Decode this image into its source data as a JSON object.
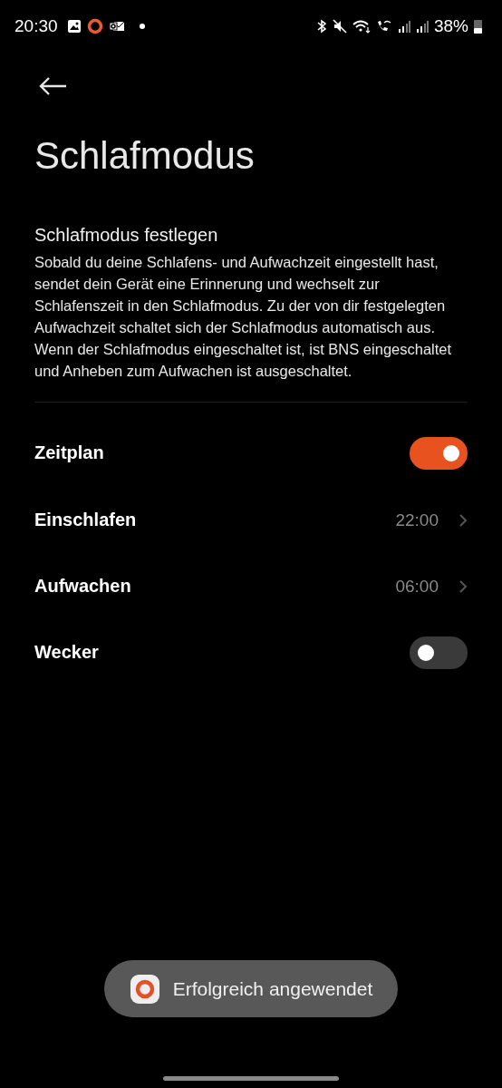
{
  "status_bar": {
    "time": "20:30",
    "battery": "38%"
  },
  "title": "Schlafmodus",
  "section": {
    "heading": "Schlafmodus festlegen",
    "description": "Sobald du deine Schlafens- und Aufwachzeit eingestellt hast, sendet dein Gerät eine Erinnerung und wechselt zur Schlafenszeit in den Schlafmodus. Zu der von dir festgelegten Aufwachzeit schaltet sich der Schlafmodus automatisch aus. Wenn der Schlafmodus eingeschaltet ist, ist BNS eingeschaltet und Anheben zum Aufwachen ist ausgeschaltet."
  },
  "settings": [
    {
      "kind": "toggle",
      "label": "Zeitplan",
      "on": true
    },
    {
      "kind": "value",
      "label": "Einschlafen",
      "value": "22:00"
    },
    {
      "kind": "value",
      "label": "Aufwachen",
      "value": "06:00"
    },
    {
      "kind": "toggle",
      "label": "Wecker",
      "on": false
    }
  ],
  "toast": {
    "text": "Erfolgreich angewendet"
  }
}
